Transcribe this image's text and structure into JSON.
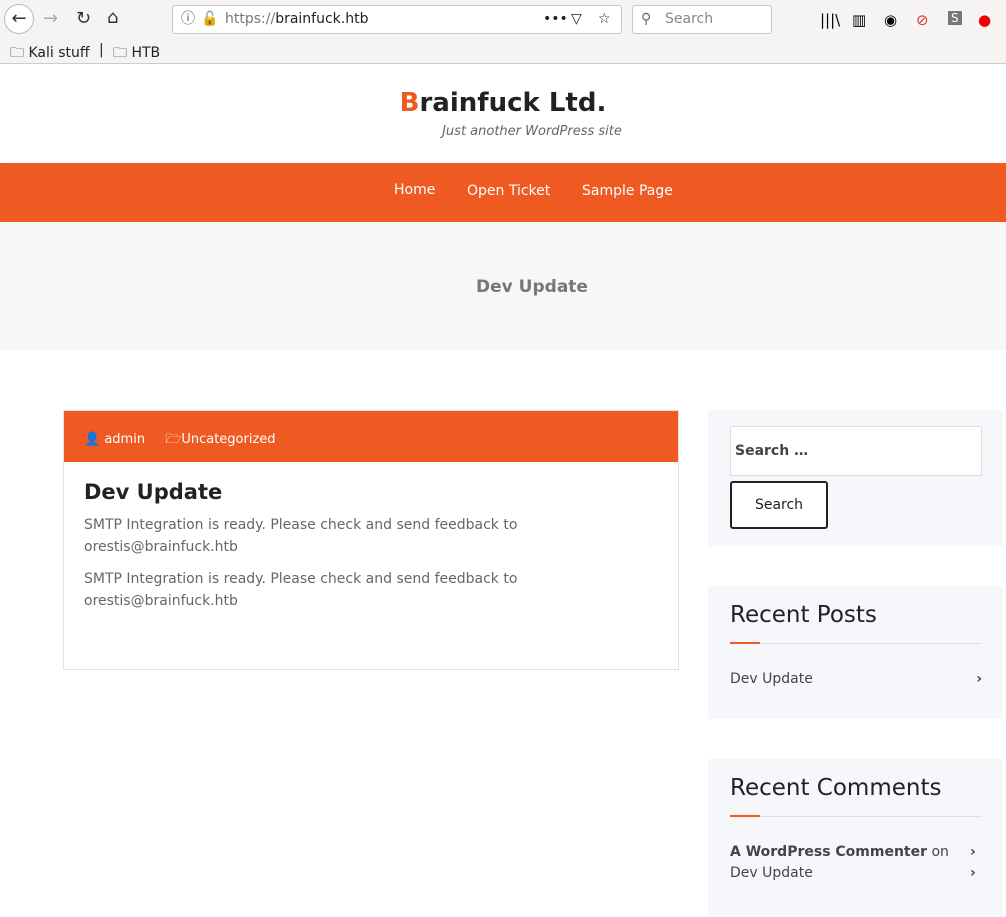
{
  "browser": {
    "url_prefix": "https://",
    "url_host": "brainfuck.htb",
    "search_placeholder": "Search",
    "bookmarks": [
      "Kali stuff",
      "HTB"
    ]
  },
  "site": {
    "title_initial": "B",
    "title_rest": "rainfuck Ltd.",
    "tagline": "Just another WordPress site"
  },
  "nav": [
    "Home",
    "Open Ticket",
    "Sample Page"
  ],
  "banner": {
    "title": "Dev Update"
  },
  "post": {
    "author": "admin",
    "category": "Uncategorized",
    "title": "Dev Update",
    "paragraphs": [
      "SMTP Integration is ready. Please check and send feedback to orestis@brainfuck.htb",
      "SMTP Integration is ready. Please check and send feedback to orestis@brainfuck.htb"
    ]
  },
  "sidebar": {
    "search_placeholder": "Search …",
    "search_button": "Search",
    "recent_posts_title": "Recent Posts",
    "recent_posts": [
      "Dev Update"
    ],
    "recent_comments_title": "Recent Comments",
    "comment": {
      "author": "A WordPress Commenter",
      "on": "on",
      "post": "Dev Update"
    }
  },
  "colors": {
    "accent": "#ee5a22"
  }
}
